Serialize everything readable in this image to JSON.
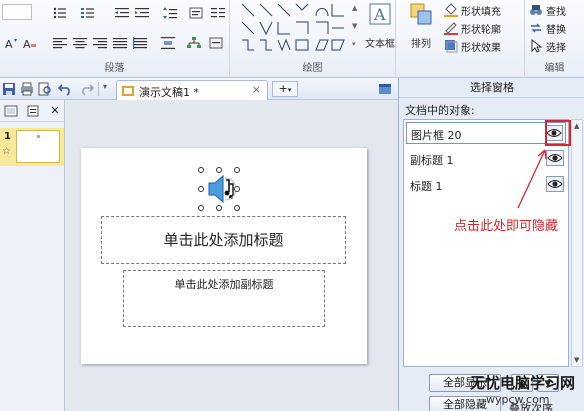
{
  "ribbon": {
    "groups": [
      {
        "label": "段落"
      },
      {
        "label": "绘图"
      },
      {
        "label": "编辑"
      }
    ],
    "textbox_label": "文本框",
    "arrange_label": "排列",
    "shape_fill_label": "形状填充",
    "shape_outline_label": "形状轮廓",
    "shape_effect_label": "形状效果",
    "find_label": "查找",
    "replace_label": "替换",
    "select_label": "选择"
  },
  "tabs": {
    "doc_title": "演示文稿1 *",
    "close": "×",
    "plus": "+"
  },
  "leftpane": {
    "close": "✕",
    "slide_number": "1",
    "slide_star": "☆"
  },
  "slide": {
    "title_placeholder": "单击此处添加标题",
    "subtitle_placeholder": "单击此处添加副标题"
  },
  "selection_pane": {
    "title": "选择窗格",
    "subtitle": "文档中的对象:",
    "items": [
      {
        "label": "图片框 20"
      },
      {
        "label": "副标题 1"
      },
      {
        "label": "标题 1"
      }
    ],
    "show_all_button": "全部显示",
    "hide_all_button": "全部隐藏",
    "order_label": "叠放次序"
  },
  "annotation": "点击此处即可隐藏",
  "watermark": {
    "title": "无忧电脑学习网",
    "url": "wypcw.com"
  },
  "colors": {
    "accent_red": "#d9262c",
    "ribbon_bg": "#e9eef6",
    "pane_bg": "#e6ecf5"
  }
}
